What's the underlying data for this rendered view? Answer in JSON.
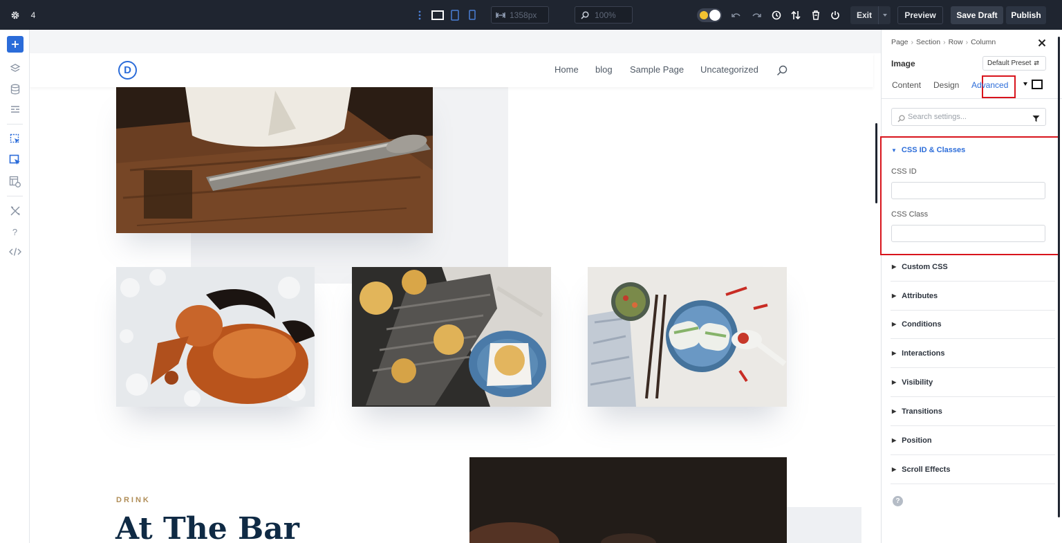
{
  "topbar": {
    "page_count": "4",
    "width_value": "1358px",
    "zoom_value": "100%",
    "exit_label": "Exit",
    "preview_label": "Preview",
    "save_draft_label": "Save Draft",
    "publish_label": "Publish"
  },
  "site": {
    "logo_letter": "D",
    "menu": [
      "Home",
      "blog",
      "Sample Page",
      "Uncategorized"
    ],
    "drink_eyebrow": "DRINK",
    "bar_heading": "At The Bar"
  },
  "panel": {
    "breadcrumb": [
      "Page",
      "Section",
      "Row",
      "Column"
    ],
    "element_title": "Image",
    "preset_label": "Default Preset",
    "tabs": [
      "Content",
      "Design",
      "Advanced"
    ],
    "active_tab": "Advanced",
    "search_placeholder": "Search settings...",
    "open_group": {
      "title": "CSS ID & Classes",
      "css_id_label": "CSS ID",
      "css_id_value": "",
      "css_class_label": "CSS Class",
      "css_class_value": ""
    },
    "groups": [
      "Custom CSS",
      "Attributes",
      "Conditions",
      "Interactions",
      "Visibility",
      "Transitions",
      "Position",
      "Scroll Effects"
    ]
  },
  "colors": {
    "topbar_bg": "#1f2530",
    "accent_blue": "#2b6cd9",
    "highlight_red": "#d8141c",
    "save_draft_bg": "#363e4c",
    "publish_bg": "#2c3442",
    "heading_navy": "#0f2a44",
    "eyebrow_gold": "#b08d57"
  }
}
